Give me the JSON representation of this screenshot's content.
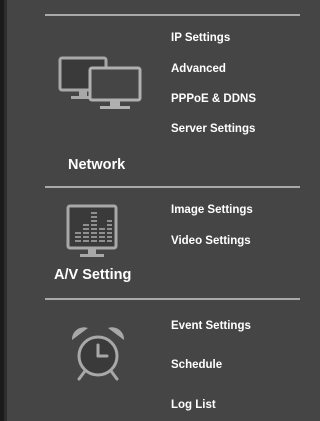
{
  "sections": [
    {
      "title": "Network",
      "icon": "network-computers-icon",
      "items": [
        "IP Settings",
        "Advanced",
        "PPPoE & DDNS",
        "Server Settings"
      ]
    },
    {
      "title": "A/V Setting",
      "icon": "av-equalizer-monitor-icon",
      "items": [
        "Image Settings",
        "Video Settings"
      ]
    },
    {
      "title": "",
      "icon": "alarm-clock-icon",
      "items": [
        "Event Settings",
        "Schedule",
        "Log List"
      ]
    }
  ],
  "colors": {
    "background": "#454545",
    "text": "#ffffff",
    "divider": "#a9a9a9",
    "icon": "#aaaaaa"
  }
}
